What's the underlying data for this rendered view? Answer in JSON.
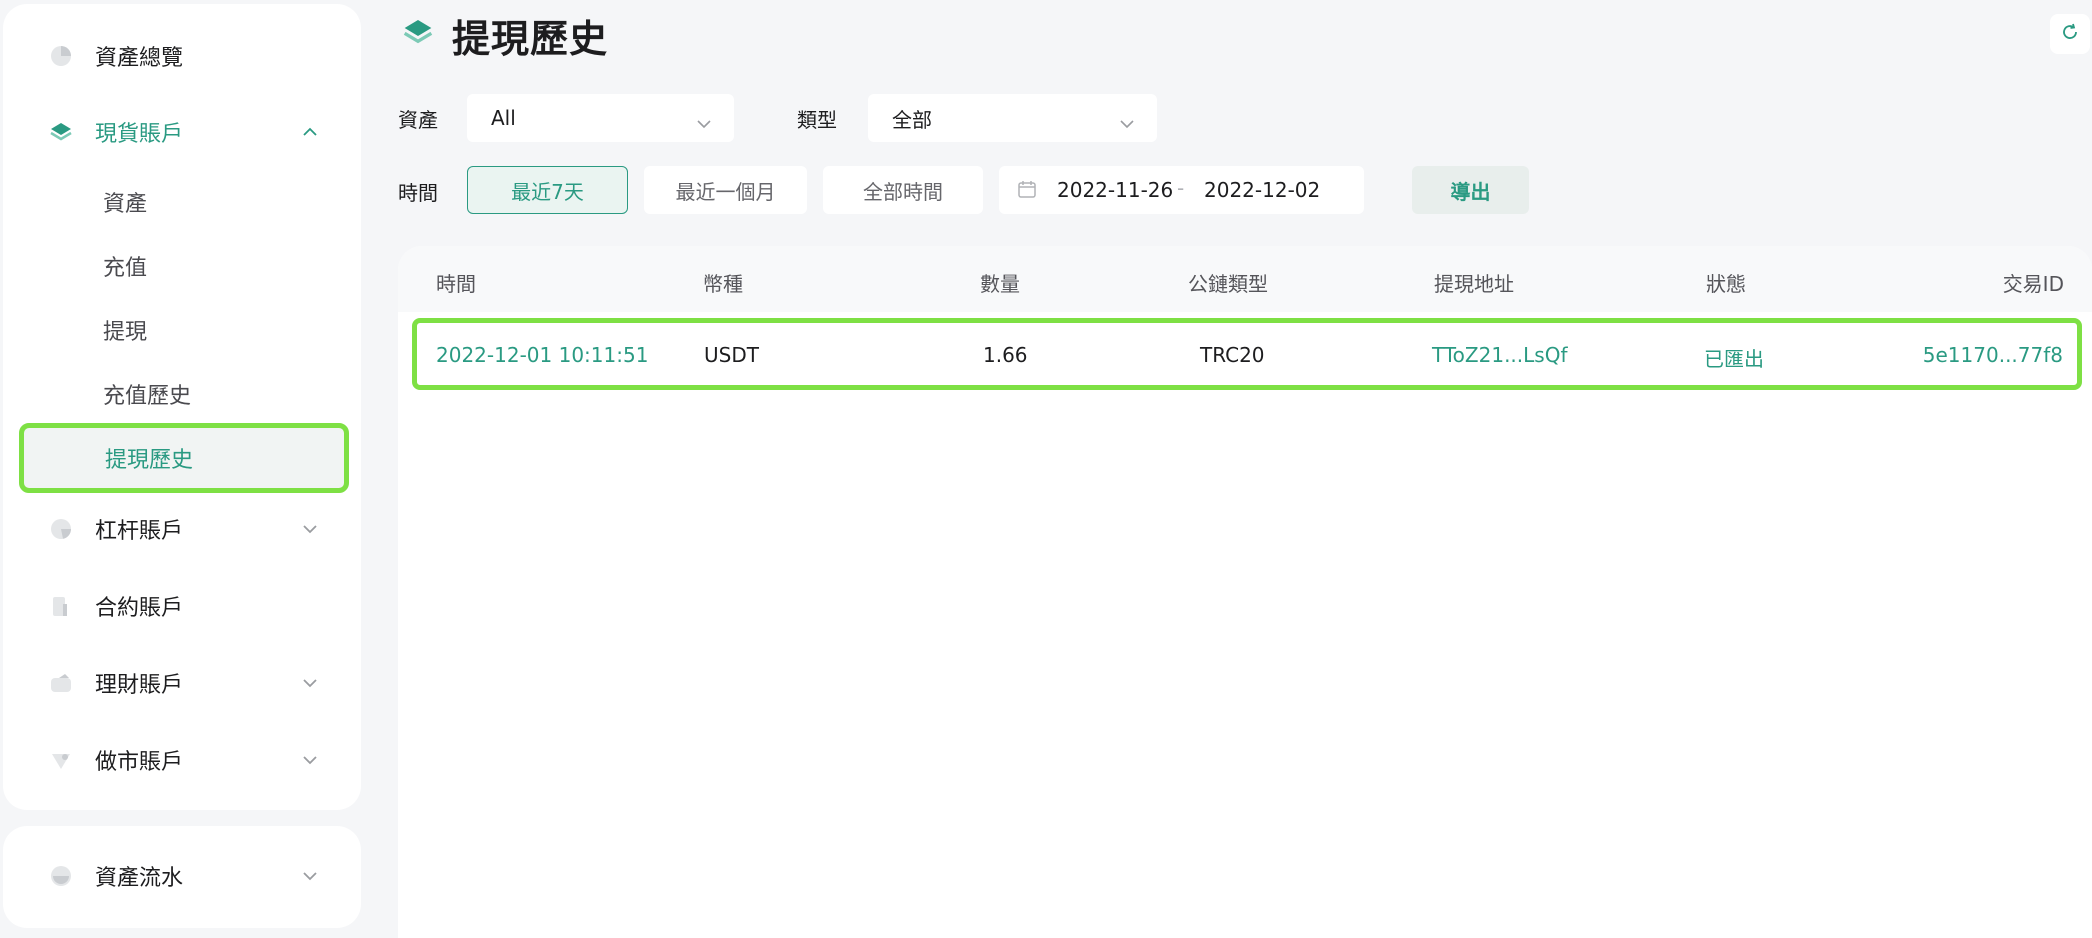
{
  "sidebar": {
    "overview_label": "資產總覽",
    "spot_label": "現貨賬戶",
    "spot_sub": [
      "資產",
      "充值",
      "提現",
      "充值歷史",
      "提現歷史"
    ],
    "margin_label": "杠杆賬戶",
    "futures_label": "合約賬戶",
    "finance_label": "理財賬戶",
    "market_maker_label": "做市賬戶",
    "flow_label": "資產流水"
  },
  "header": {
    "title": "提現歷史"
  },
  "filters": {
    "asset_label": "資產",
    "asset_value": "All",
    "type_label": "類型",
    "type_value": "全部",
    "time_label": "時間",
    "time_options": [
      "最近7天",
      "最近一個月",
      "全部時間"
    ],
    "date_start": "2022-11-26",
    "date_sep": "-",
    "date_end": "2022-12-02",
    "export_label": "導出"
  },
  "table": {
    "headers": [
      "時間",
      "幣種",
      "數量",
      "公鏈類型",
      "提現地址",
      "狀態",
      "交易ID"
    ],
    "rows": [
      [
        "2022-12-01 10:11:51",
        "USDT",
        "1.66",
        "TRC20",
        "TToZ21...LsQf",
        "已匯出",
        "5e1170...77f8"
      ]
    ]
  },
  "colors": {
    "accent": "#2a9a82",
    "highlight": "#7ee044",
    "background": "#f5f6f8"
  },
  "icons": {
    "overview": "pie-chart-icon",
    "spot": "layers-icon",
    "margin": "pie-icon",
    "futures": "bar-chart-icon",
    "finance": "wallet-icon",
    "market_maker": "diamond-icon",
    "flow": "bowl-icon",
    "refresh": "refresh-icon",
    "calendar": "calendar-icon"
  }
}
